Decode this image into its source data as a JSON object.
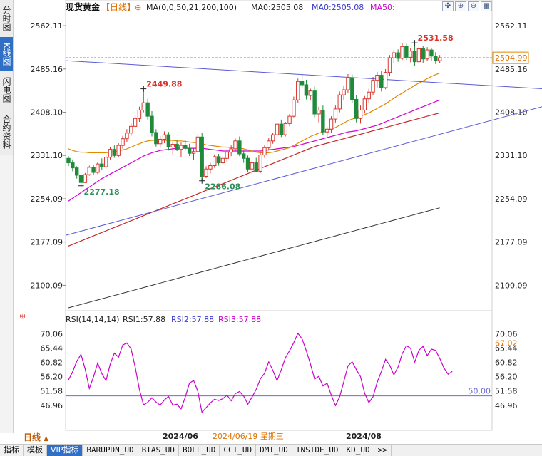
{
  "sidebar": {
    "tabs": [
      {
        "label": "分时图",
        "active": false
      },
      {
        "label": "K线图",
        "active": true
      },
      {
        "label": "闪电图",
        "active": false
      },
      {
        "label": "合约资料",
        "active": false
      }
    ]
  },
  "header": {
    "symbol": "现货黄金",
    "period": "【日线】",
    "ma_label": "MA(0,0,50,21,200,100)",
    "ma0": "MA0:2505.08",
    "ma0b": "MA0:2505.08",
    "ma50": "MA50:"
  },
  "rsi_header": {
    "label": "RSI(14,14,14)",
    "rsi1": "RSI1:57.88",
    "rsi2": "RSI2:57.88",
    "rsi3": "RSI3:57.88"
  },
  "bottom": {
    "period": "日线",
    "tabs": [
      "指标",
      "模板",
      "VIP指标",
      "BARUPDN_UD",
      "BIAS_UD",
      "BOLL_UD",
      "CCI_UD",
      "DMI_UD",
      "INSIDE_UD",
      "KD_UD",
      ">>"
    ]
  },
  "colors": {
    "up": "#d9342b",
    "down": "#1e8a3a",
    "ma21": "#e08a00",
    "ma50": "#d000d0",
    "ma100": "#c62828",
    "ma200": "#333333",
    "trend": "#5a5ad6",
    "rsi": "#cc00cc"
  },
  "chart_data": [
    {
      "type": "candlestick",
      "title": "现货黄金 日线",
      "ylim": [
        2060,
        2580
      ],
      "y_ticks": [
        2562.11,
        2485.16,
        2408.1,
        2331.1,
        2254.09,
        2177.09,
        2100.09
      ],
      "x_ticks": [
        "2024/06",
        "2024/08"
      ],
      "crosshair_date": "2024/06/19 星期三",
      "last_price": 2504.99,
      "annotations": [
        {
          "text": "2531.58",
          "value": 2531.58,
          "kind": "high"
        },
        {
          "text": "2449.88",
          "value": 2449.88,
          "kind": "high"
        },
        {
          "text": "2277.18",
          "value": 2277.18,
          "kind": "low"
        },
        {
          "text": "2286.08",
          "value": 2286.08,
          "kind": "low"
        }
      ],
      "candles": [
        [
          2326,
          2330,
          2312,
          2318
        ],
        [
          2318,
          2324,
          2303,
          2309
        ],
        [
          2309,
          2312,
          2290,
          2296
        ],
        [
          2296,
          2302,
          2277,
          2283
        ],
        [
          2283,
          2300,
          2282,
          2297
        ],
        [
          2297,
          2313,
          2295,
          2310
        ],
        [
          2310,
          2314,
          2296,
          2301
        ],
        [
          2301,
          2320,
          2298,
          2316
        ],
        [
          2316,
          2326,
          2305,
          2311
        ],
        [
          2311,
          2331,
          2309,
          2328
        ],
        [
          2328,
          2346,
          2324,
          2342
        ],
        [
          2342,
          2349,
          2327,
          2331
        ],
        [
          2331,
          2353,
          2328,
          2349
        ],
        [
          2349,
          2366,
          2343,
          2361
        ],
        [
          2361,
          2378,
          2355,
          2371
        ],
        [
          2371,
          2388,
          2366,
          2383
        ],
        [
          2383,
          2403,
          2378,
          2397
        ],
        [
          2397,
          2418,
          2391,
          2412
        ],
        [
          2412,
          2449,
          2408,
          2425
        ],
        [
          2425,
          2432,
          2395,
          2401
        ],
        [
          2401,
          2410,
          2365,
          2372
        ],
        [
          2372,
          2378,
          2347,
          2352
        ],
        [
          2352,
          2366,
          2345,
          2360
        ],
        [
          2360,
          2374,
          2353,
          2368
        ],
        [
          2368,
          2373,
          2340,
          2346
        ],
        [
          2346,
          2356,
          2333,
          2351
        ],
        [
          2351,
          2359,
          2339,
          2342
        ],
        [
          2342,
          2354,
          2328,
          2349
        ],
        [
          2349,
          2358,
          2340,
          2344
        ],
        [
          2344,
          2352,
          2330,
          2335
        ],
        [
          2335,
          2344,
          2323,
          2338
        ],
        [
          2338,
          2369,
          2336,
          2364
        ],
        [
          2364,
          2371,
          2286,
          2294
        ],
        [
          2294,
          2312,
          2291,
          2307
        ],
        [
          2307,
          2318,
          2299,
          2313
        ],
        [
          2313,
          2333,
          2309,
          2329
        ],
        [
          2329,
          2334,
          2313,
          2318
        ],
        [
          2318,
          2330,
          2312,
          2326
        ],
        [
          2326,
          2342,
          2320,
          2337
        ],
        [
          2337,
          2349,
          2330,
          2343
        ],
        [
          2343,
          2361,
          2338,
          2357
        ],
        [
          2357,
          2365,
          2330,
          2334
        ],
        [
          2334,
          2340,
          2318,
          2326
        ],
        [
          2326,
          2331,
          2302,
          2307
        ],
        [
          2307,
          2322,
          2298,
          2318
        ],
        [
          2318,
          2327,
          2301,
          2303
        ],
        [
          2303,
          2338,
          2300,
          2332
        ],
        [
          2332,
          2349,
          2327,
          2345
        ],
        [
          2345,
          2363,
          2340,
          2357
        ],
        [
          2357,
          2372,
          2352,
          2368
        ],
        [
          2368,
          2392,
          2362,
          2387
        ],
        [
          2387,
          2395,
          2364,
          2368
        ],
        [
          2368,
          2391,
          2365,
          2388
        ],
        [
          2388,
          2405,
          2383,
          2401
        ],
        [
          2401,
          2436,
          2399,
          2430
        ],
        [
          2430,
          2468,
          2425,
          2463
        ],
        [
          2463,
          2477,
          2450,
          2457
        ],
        [
          2457,
          2466,
          2431,
          2438
        ],
        [
          2438,
          2450,
          2430,
          2446
        ],
        [
          2446,
          2454,
          2399,
          2405
        ],
        [
          2405,
          2418,
          2390,
          2412
        ],
        [
          2412,
          2420,
          2367,
          2373
        ],
        [
          2373,
          2382,
          2362,
          2378
        ],
        [
          2378,
          2401,
          2372,
          2396
        ],
        [
          2396,
          2420,
          2390,
          2414
        ],
        [
          2414,
          2445,
          2408,
          2439
        ],
        [
          2439,
          2455,
          2430,
          2448
        ],
        [
          2448,
          2476,
          2443,
          2469
        ],
        [
          2469,
          2475,
          2425,
          2431
        ],
        [
          2431,
          2438,
          2390,
          2397
        ],
        [
          2397,
          2420,
          2388,
          2412
        ],
        [
          2412,
          2437,
          2406,
          2432
        ],
        [
          2432,
          2450,
          2425,
          2444
        ],
        [
          2444,
          2471,
          2439,
          2465
        ],
        [
          2465,
          2480,
          2452,
          2474
        ],
        [
          2474,
          2481,
          2445,
          2452
        ],
        [
          2452,
          2485,
          2449,
          2479
        ],
        [
          2479,
          2510,
          2472,
          2505
        ],
        [
          2505,
          2519,
          2495,
          2514
        ],
        [
          2514,
          2520,
          2498,
          2504
        ],
        [
          2504,
          2531,
          2501,
          2525
        ],
        [
          2525,
          2530,
          2501,
          2506
        ],
        [
          2506,
          2522,
          2497,
          2517
        ],
        [
          2517,
          2526,
          2491,
          2498
        ],
        [
          2498,
          2527,
          2494,
          2521
        ],
        [
          2521,
          2526,
          2496,
          2503
        ],
        [
          2503,
          2524,
          2499,
          2519
        ],
        [
          2519,
          2523,
          2500,
          2508
        ],
        [
          2508,
          2515,
          2494,
          2500
        ],
        [
          2500,
          2510,
          2495,
          2505
        ]
      ],
      "ma21": [
        2343,
        2340,
        2338,
        2337,
        2337,
        2336,
        2336,
        2336,
        2336,
        2336,
        2337,
        2338,
        2339,
        2341,
        2343,
        2346,
        2349,
        2352,
        2355,
        2357,
        2358,
        2358,
        2358,
        2358,
        2358,
        2358,
        2357,
        2357,
        2356,
        2355,
        2354,
        2354,
        2352,
        2350,
        2349,
        2348,
        2347,
        2346,
        2346,
        2345,
        2345,
        2344,
        2343,
        2341,
        2339,
        2337,
        2336,
        2336,
        2336,
        2337,
        2339,
        2341,
        2343,
        2345,
        2349,
        2353,
        2357,
        2361,
        2365,
        2368,
        2371,
        2373,
        2375,
        2378,
        2381,
        2385,
        2389,
        2393,
        2396,
        2398,
        2401,
        2404,
        2407,
        2411,
        2415,
        2419,
        2423,
        2428,
        2433,
        2438,
        2442,
        2447,
        2451,
        2456,
        2460,
        2464,
        2468,
        2472,
        2475,
        2478
      ],
      "ma50": [
        2250,
        2255,
        2260,
        2265,
        2270,
        2275,
        2280,
        2285,
        2290,
        2294,
        2298,
        2302,
        2306,
        2310,
        2314,
        2318,
        2322,
        2326,
        2330,
        2333,
        2336,
        2338,
        2340,
        2341,
        2342,
        2343,
        2344,
        2344,
        2344,
        2344,
        2344,
        2344,
        2344,
        2343,
        2342,
        2341,
        2340,
        2339,
        2339,
        2339,
        2339,
        2339,
        2339,
        2339,
        2339,
        2339,
        2339,
        2340,
        2341,
        2342,
        2343,
        2344,
        2345,
        2346,
        2347,
        2349,
        2351,
        2353,
        2355,
        2357,
        2359,
        2361,
        2363,
        2365,
        2367,
        2369,
        2371,
        2373,
        2374,
        2375,
        2377,
        2379,
        2381,
        2383,
        2385,
        2388,
        2391,
        2394,
        2397,
        2400,
        2403,
        2406,
        2409,
        2412,
        2415,
        2418,
        2421,
        2424,
        2427,
        2430
      ],
      "ma100": [
        2170,
        2173,
        2176,
        2179,
        2182,
        2185,
        2188,
        2191,
        2194,
        2197,
        2200,
        2203,
        2206,
        2209,
        2212,
        2215,
        2218,
        2221,
        2224,
        2227,
        2230,
        2233,
        2236,
        2239,
        2242,
        2245,
        2248,
        2251,
        2254,
        2257,
        2260,
        2263,
        2266,
        2269,
        2272,
        2275,
        2278,
        2281,
        2284,
        2287,
        2290,
        2293,
        2296,
        2299,
        2302,
        2305,
        2308,
        2311,
        2314,
        2317,
        2320,
        2323,
        2326,
        2329,
        2332,
        2335,
        2338,
        2341,
        2344,
        2347,
        2349,
        2351,
        2353,
        2355,
        2357,
        2359,
        2361,
        2363,
        2365,
        2367,
        2369,
        2371,
        2373,
        2375,
        2377,
        2379,
        2381,
        2383,
        2385,
        2387,
        2389,
        2391,
        2393,
        2395,
        2397,
        2399,
        2401,
        2403,
        2405,
        2407
      ],
      "ma200": [
        2060,
        2062,
        2064,
        2066,
        2068,
        2070,
        2072,
        2074,
        2076,
        2078,
        2080,
        2082,
        2084,
        2086,
        2088,
        2090,
        2092,
        2094,
        2096,
        2098,
        2100,
        2102,
        2104,
        2106,
        2108,
        2110,
        2112,
        2114,
        2116,
        2118,
        2120,
        2122,
        2124,
        2126,
        2128,
        2130,
        2132,
        2134,
        2136,
        2138,
        2140,
        2142,
        2144,
        2146,
        2148,
        2150,
        2152,
        2154,
        2156,
        2158,
        2160,
        2162,
        2164,
        2166,
        2168,
        2170,
        2172,
        2174,
        2176,
        2178,
        2180,
        2182,
        2184,
        2186,
        2188,
        2190,
        2192,
        2194,
        2196,
        2198,
        2200,
        2202,
        2204,
        2206,
        2208,
        2210,
        2212,
        2214,
        2216,
        2218,
        2220,
        2222,
        2224,
        2226,
        2228,
        2230,
        2232,
        2234,
        2236,
        2238
      ],
      "trendlines": [
        {
          "from": [
            0,
            2500
          ],
          "to": [
            118,
            2448
          ]
        },
        {
          "from": [
            0,
            2189
          ],
          "to": [
            118,
            2427
          ]
        }
      ]
    },
    {
      "type": "line",
      "title": "RSI(14,14,14)",
      "ylim": [
        43,
        72
      ],
      "y_ticks": [
        70.06,
        65.44,
        60.82,
        56.2,
        51.58,
        46.96
      ],
      "reference_line": 50.0,
      "last_value": 67.02,
      "rsi": [
        55.1,
        57.8,
        61.2,
        63.4,
        58.7,
        52.4,
        56.1,
        60.6,
        57.2,
        54.9,
        60.2,
        63.8,
        62.5,
        66.4,
        67.1,
        65.2,
        59.3,
        52.1,
        47.1,
        47.9,
        49.4,
        48.0,
        47.0,
        48.7,
        49.8,
        47.0,
        47.3,
        45.8,
        49.6,
        54.1,
        55.0,
        51.5,
        44.7,
        46.2,
        47.7,
        48.9,
        48.5,
        49.1,
        50.2,
        48.4,
        50.7,
        51.4,
        49.9,
        47.3,
        49.6,
        52.1,
        55.5,
        57.3,
        61.0,
        58.2,
        54.9,
        58.4,
        62.3,
        64.6,
        67.2,
        70.2,
        68.4,
        64.6,
        60.3,
        55.4,
        56.3,
        53.2,
        54.1,
        50.2,
        46.9,
        49.7,
        54.6,
        59.7,
        61.0,
        58.5,
        56.2,
        50.8,
        47.8,
        49.7,
        54.4,
        57.9,
        61.8,
        59.9,
        56.8,
        59.3,
        63.6,
        66.2,
        65.4,
        60.9,
        64.7,
        66.0,
        63.0,
        65.1,
        64.7,
        62.1,
        59.0,
        57.0,
        57.9
      ]
    }
  ]
}
